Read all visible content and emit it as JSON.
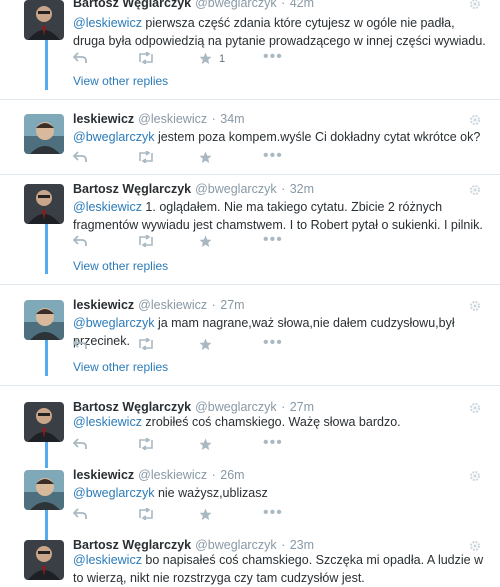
{
  "view_other_replies": "View other replies",
  "tweets": [
    {
      "author": "Bartosz Węglarczyk",
      "handle": "@bweglarczyk",
      "time": "42m",
      "mention": "@leskiewicz",
      "text": " pierwsza część zdania które cytujesz w ogóle nie padła, druga była odpowiedzią na pytanie prowadzącego w innej części wywiadu.",
      "favorite_count": "1"
    },
    {
      "author": "leskiewicz",
      "handle": "@leskiewicz",
      "time": "34m",
      "mention": "@bweglarczyk",
      "text": " jestem poza kompem.wyśle Ci dokładny cytat wkrótce ok?"
    },
    {
      "author": "Bartosz Węglarczyk",
      "handle": "@bweglarczyk",
      "time": "32m",
      "mention": "@leskiewicz",
      "text": " 1. oglądałem. Nie ma takiego cytatu. Zbicie 2 różnych fragmentów wywiadu jest chamstwem. I to Robert pytał o sukienki. I pilnik."
    },
    {
      "author": "leskiewicz",
      "handle": "@leskiewicz",
      "time": "27m",
      "mention": "@bweglarczyk",
      "text": " ja mam nagrane,waż  słowa,nie dałem cudzysłowu,był przecinek."
    },
    {
      "author": "Bartosz Węglarczyk",
      "handle": "@bweglarczyk",
      "time": "27m",
      "mention": "@leskiewicz",
      "text": " zrobiłeś coś chamskiego. Ważę słowa bardzo."
    },
    {
      "author": "leskiewicz",
      "handle": "@leskiewicz",
      "time": "26m",
      "mention": "@bweglarczyk",
      "text": " nie ważysz,ublizasz"
    },
    {
      "author": "Bartosz Węglarczyk",
      "handle": "@bweglarczyk",
      "time": "23m",
      "mention": "@leskiewicz",
      "text": " bo napisałeś coś chamskiego. Szczęka mi opadła. A ludzie w to wierzą, nikt nie rozstrzyga czy tam cudzysłów jest."
    }
  ]
}
